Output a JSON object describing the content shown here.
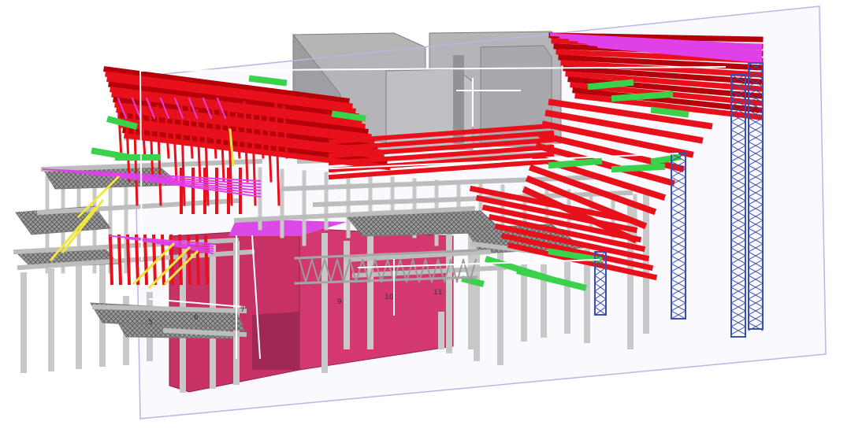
{
  "viewport": {
    "background": "#ffffff",
    "model": "structural-bim-3d-model"
  },
  "palette": {
    "concrete_wall": "#b5b5b5",
    "concrete_wall_dark": "#8f8f8f",
    "steel_column": "#c8c8c8",
    "red_beam": "#e8101a",
    "red_beam_dark": "#b5000a",
    "magenta_slab": "#e040e8",
    "green_brace": "#39d24a",
    "yellow_brace": "#f2e640",
    "blue_truss": "#3a4fb0",
    "crimson_volume": "#c8265c",
    "crimson_volume_dark": "#9e1d48",
    "section_plane": "#b9b6e8",
    "grating": "#6e6e6e"
  },
  "grid_labels": [
    "5",
    "6",
    "7",
    "9",
    "10",
    "11"
  ]
}
